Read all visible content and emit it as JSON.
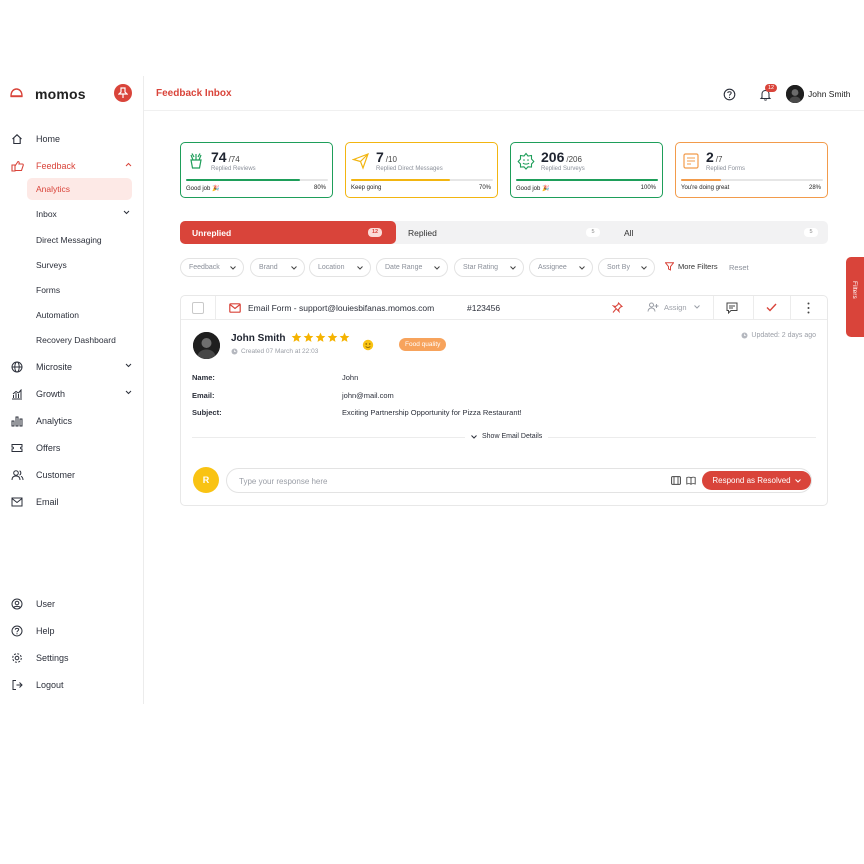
{
  "app": {
    "brand": "momos",
    "page_title": "Feedback Inbox",
    "user_name": "John Smith",
    "notification_count": "12"
  },
  "sidebar": {
    "items": [
      {
        "label": "Home",
        "icon": "home-icon"
      },
      {
        "label": "Feedback",
        "icon": "feedback-icon",
        "expanded": true
      },
      {
        "label": "Microsite",
        "icon": "globe-icon"
      },
      {
        "label": "Growth",
        "icon": "growth-icon"
      },
      {
        "label": "Analytics",
        "icon": "analytics-icon"
      },
      {
        "label": "Offers",
        "icon": "offers-icon"
      },
      {
        "label": "Customer",
        "icon": "customer-icon"
      },
      {
        "label": "Email",
        "icon": "email-icon"
      }
    ],
    "feedback_sub": [
      {
        "label": "Analytics",
        "selected": true
      },
      {
        "label": "Inbox"
      },
      {
        "label": "Direct Messaging"
      },
      {
        "label": "Surveys"
      },
      {
        "label": "Forms"
      },
      {
        "label": "Automation"
      },
      {
        "label": "Recovery Dashboard"
      }
    ],
    "bottom": [
      {
        "label": "User",
        "icon": "user-icon"
      },
      {
        "label": "Help",
        "icon": "help-icon"
      },
      {
        "label": "Settings",
        "icon": "settings-icon"
      },
      {
        "label": "Logout",
        "icon": "logout-icon"
      }
    ]
  },
  "stats": [
    {
      "value": "74",
      "total": "/74",
      "label": "Replied Reviews",
      "message": "Good job 🎉",
      "percent_text": "80%",
      "progress": 0.8,
      "color": "#1e9e5a"
    },
    {
      "value": "7",
      "total": "/10",
      "label": "Replied Direct Messages",
      "message": "Keep going",
      "percent_text": "70%",
      "progress": 0.7,
      "color": "#f2b511"
    },
    {
      "value": "206",
      "total": "/206",
      "label": "Replied Surveys",
      "message": "Good job 🎉",
      "percent_text": "100%",
      "progress": 1.0,
      "color": "#1e9e5a"
    },
    {
      "value": "2",
      "total": "/7",
      "label": "Replied Forms",
      "message": "You're doing great",
      "percent_text": "28%",
      "progress": 0.28,
      "color": "#f29b4b"
    }
  ],
  "tabs": [
    {
      "label": "Unreplied",
      "count": "12",
      "active": true
    },
    {
      "label": "Replied",
      "count": "5"
    },
    {
      "label": "All",
      "count": "5"
    }
  ],
  "filters": [
    "Feedback",
    "Brand",
    "Location",
    "Date Range",
    "Star Rating",
    "Assignee",
    "Sort By"
  ],
  "more_filters_label": "More Filters",
  "reset_label": "Reset",
  "side_filters_label": "Filters",
  "feedback": {
    "source": "Email Form - support@louiesbifanas.momos.com",
    "id": "#123456",
    "assign_label": "Assign",
    "name": "John Smith",
    "rating": 5,
    "created": "Created 07 March at 22:03",
    "tag": "Food quality",
    "updated": "Updated: 2 days ago",
    "fields": [
      {
        "label": "Name:",
        "value": "John"
      },
      {
        "label": "Email:",
        "value": "john@mail.com"
      },
      {
        "label": "Subject:",
        "value": "Exciting Partnership Opportunity for Pizza Restaurant!"
      }
    ],
    "show_details": "Show Email Details",
    "reply_initial": "R",
    "reply_placeholder": "Type your response here",
    "respond_button": "Respond as Resolved"
  },
  "colors": {
    "accent": "#d9443a",
    "green": "#1e9e5a",
    "yellow": "#f2b511",
    "orange": "#f29b4b",
    "star": "#f5b301"
  }
}
